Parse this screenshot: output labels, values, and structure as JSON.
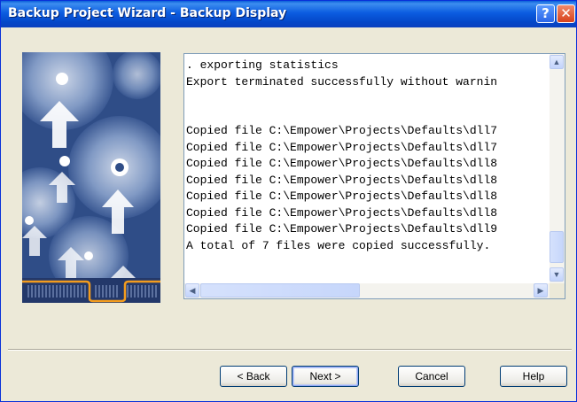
{
  "window": {
    "title": "Backup Project Wizard - Backup Display"
  },
  "title_buttons": {
    "help_glyph": "?",
    "close_glyph": "✕"
  },
  "log": {
    "lines": [
      ". exporting statistics",
      "Export terminated successfully without warnin",
      "",
      "",
      "Copied file C:\\Empower\\Projects\\Defaults\\dll7",
      "Copied file C:\\Empower\\Projects\\Defaults\\dll7",
      "Copied file C:\\Empower\\Projects\\Defaults\\dll8",
      "Copied file C:\\Empower\\Projects\\Defaults\\dll8",
      "Copied file C:\\Empower\\Projects\\Defaults\\dll8",
      "Copied file C:\\Empower\\Projects\\Defaults\\dll8",
      "Copied file C:\\Empower\\Projects\\Defaults\\dll9",
      "A total of 7 files were copied successfully."
    ]
  },
  "buttons": {
    "back": "< Back",
    "next": "Next >",
    "cancel": "Cancel",
    "help": "Help"
  },
  "colors": {
    "title_bar": "#0b5ce0",
    "dialog_bg": "#ece9d8",
    "wizard_image_bg": "#2e4b84"
  }
}
